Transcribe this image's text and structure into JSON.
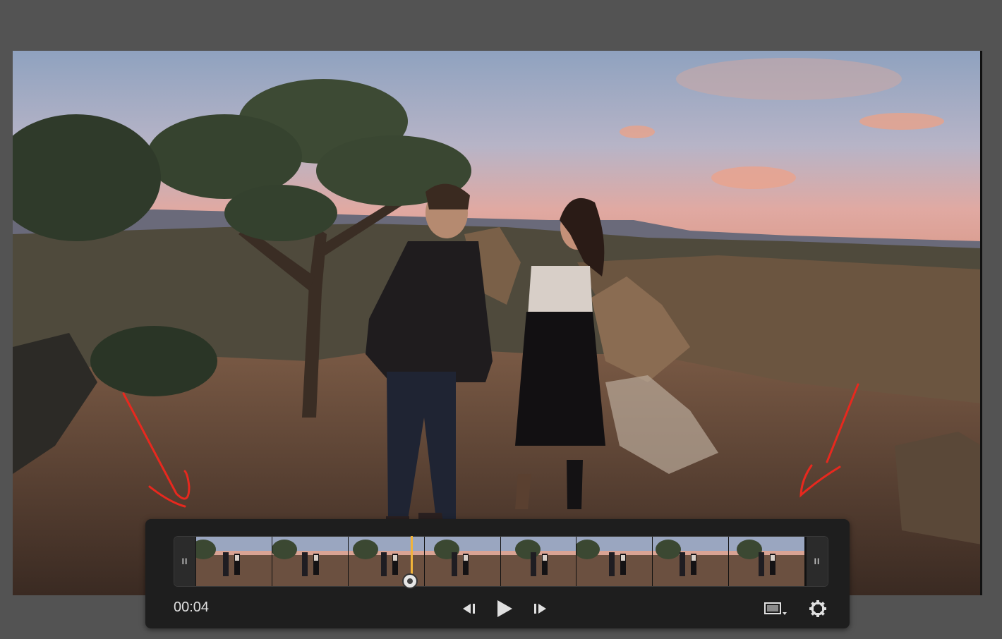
{
  "player": {
    "timecode": "00:04",
    "playhead_fraction": 0.36,
    "thumbnail_count": 8
  },
  "icons": {
    "trim_left": "trim-handle-grip",
    "trim_right": "trim-handle-grip",
    "previous_frame": "step-back-icon",
    "play": "play-icon",
    "next_frame": "step-forward-icon",
    "aspect": "aspect-ratio-icon",
    "settings": "gear-icon"
  },
  "colors": {
    "background": "#535353",
    "control_bar": "#1e1e1e",
    "playhead": "#f2b43a",
    "annotation": "#e8281e"
  }
}
